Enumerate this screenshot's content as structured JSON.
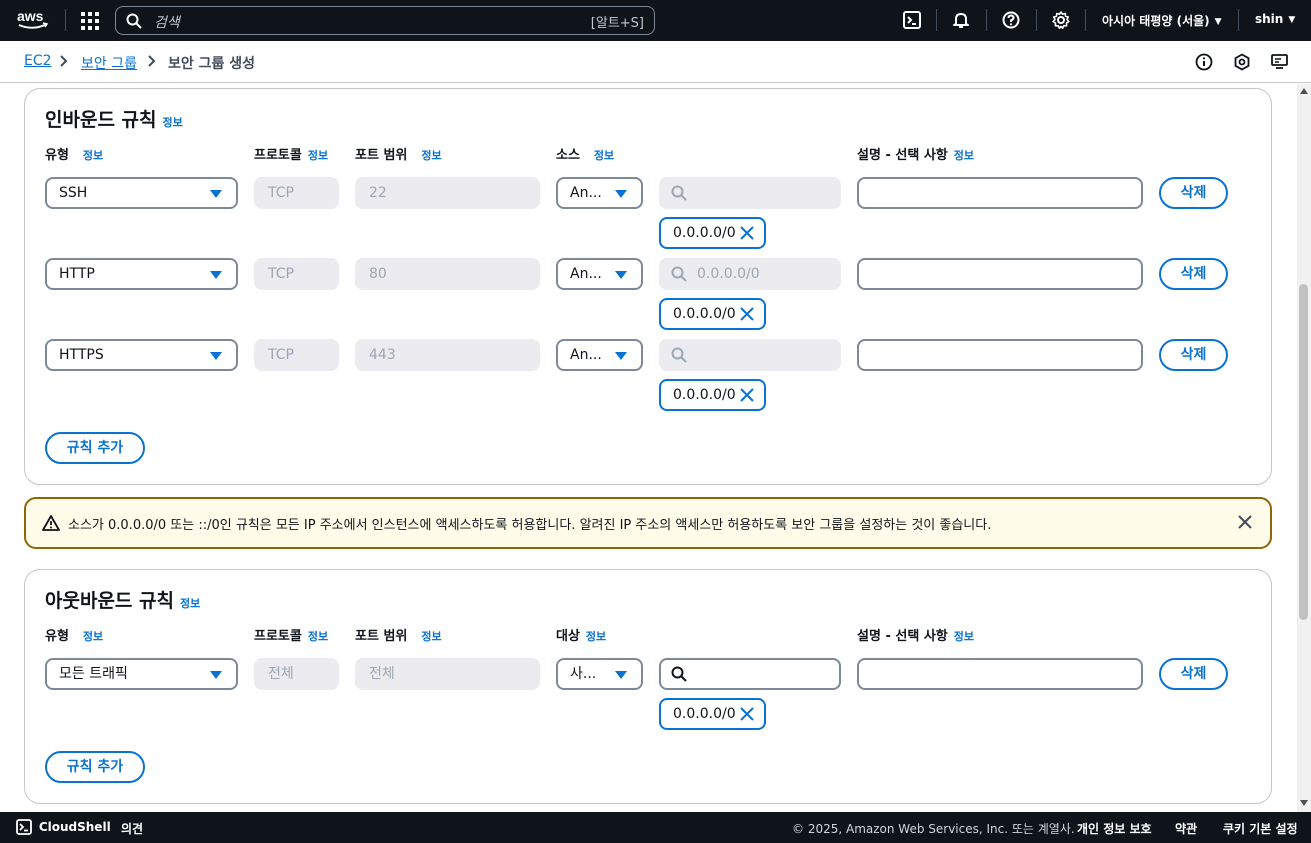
{
  "topnav": {
    "search_placeholder": "검색",
    "search_shortcut": "[알트+S]",
    "region": "아시아 태평양 (서울)",
    "user": "shin"
  },
  "breadcrumb": {
    "items": [
      "EC2",
      "보안 그룹",
      "보안 그룹 생성"
    ]
  },
  "inbound": {
    "title": "인바운드 규칙",
    "info": "정보",
    "headers": {
      "type": "유형",
      "protocol": "프로토콜",
      "port": "포트 범위",
      "source": "소스",
      "description": "설명 - 선택 사항"
    },
    "rules": [
      {
        "type": "SSH",
        "protocol": "TCP",
        "port": "22",
        "source_type": "An...",
        "search": "",
        "cidr": "0.0.0.0/0",
        "delete": "삭제"
      },
      {
        "type": "HTTP",
        "protocol": "TCP",
        "port": "80",
        "source_type": "An...",
        "search": "0.0.0.0/0",
        "cidr": "0.0.0.0/0",
        "delete": "삭제"
      },
      {
        "type": "HTTPS",
        "protocol": "TCP",
        "port": "443",
        "source_type": "An...",
        "search": "",
        "cidr": "0.0.0.0/0",
        "delete": "삭제"
      }
    ],
    "add_rule": "규칙 추가"
  },
  "alert": {
    "message": "소스가 0.0.0.0/0 또는 ::/0인 규칙은 모든 IP 주소에서 인스턴스에 액세스하도록 허용합니다. 알려진 IP 주소의 액세스만 허용하도록 보안 그룹을 설정하는 것이 좋습니다."
  },
  "outbound": {
    "title": "아웃바운드 규칙",
    "info": "정보",
    "headers": {
      "type": "유형",
      "protocol": "프로토콜",
      "port": "포트 범위",
      "destination": "대상",
      "description": "설명 - 선택 사항"
    },
    "rules": [
      {
        "type": "모든 트래픽",
        "protocol": "전체",
        "port": "전체",
        "dest_type": "사...",
        "search": "",
        "cidr": "0.0.0.0/0",
        "delete": "삭제"
      }
    ],
    "add_rule": "규칙 추가"
  },
  "footer": {
    "cloudshell": "CloudShell",
    "feedback": "의견",
    "copyright": "© 2025, Amazon Web Services, Inc. 또는 계열사.",
    "privacy": "개인 정보 보호",
    "terms": "약관",
    "cookies": "쿠키 기본 설정"
  },
  "colors": {
    "nav_bg": "#0f141a",
    "link": "#0972d3",
    "warning_border": "#8d6605",
    "warning_bg": "#fffce9"
  }
}
